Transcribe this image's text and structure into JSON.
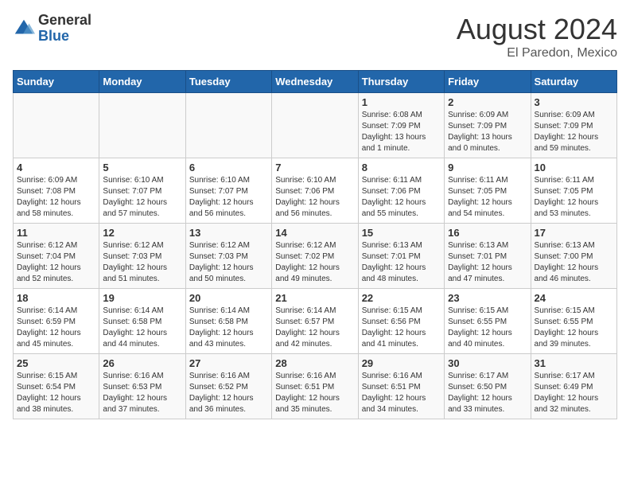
{
  "header": {
    "logo_general": "General",
    "logo_blue": "Blue",
    "month_title": "August 2024",
    "subtitle": "El Paredon, Mexico"
  },
  "days_of_week": [
    "Sunday",
    "Monday",
    "Tuesday",
    "Wednesday",
    "Thursday",
    "Friday",
    "Saturday"
  ],
  "weeks": [
    [
      {
        "num": "",
        "info": ""
      },
      {
        "num": "",
        "info": ""
      },
      {
        "num": "",
        "info": ""
      },
      {
        "num": "",
        "info": ""
      },
      {
        "num": "1",
        "info": "Sunrise: 6:08 AM\nSunset: 7:09 PM\nDaylight: 13 hours\nand 1 minute."
      },
      {
        "num": "2",
        "info": "Sunrise: 6:09 AM\nSunset: 7:09 PM\nDaylight: 13 hours\nand 0 minutes."
      },
      {
        "num": "3",
        "info": "Sunrise: 6:09 AM\nSunset: 7:09 PM\nDaylight: 12 hours\nand 59 minutes."
      }
    ],
    [
      {
        "num": "4",
        "info": "Sunrise: 6:09 AM\nSunset: 7:08 PM\nDaylight: 12 hours\nand 58 minutes."
      },
      {
        "num": "5",
        "info": "Sunrise: 6:10 AM\nSunset: 7:07 PM\nDaylight: 12 hours\nand 57 minutes."
      },
      {
        "num": "6",
        "info": "Sunrise: 6:10 AM\nSunset: 7:07 PM\nDaylight: 12 hours\nand 56 minutes."
      },
      {
        "num": "7",
        "info": "Sunrise: 6:10 AM\nSunset: 7:06 PM\nDaylight: 12 hours\nand 56 minutes."
      },
      {
        "num": "8",
        "info": "Sunrise: 6:11 AM\nSunset: 7:06 PM\nDaylight: 12 hours\nand 55 minutes."
      },
      {
        "num": "9",
        "info": "Sunrise: 6:11 AM\nSunset: 7:05 PM\nDaylight: 12 hours\nand 54 minutes."
      },
      {
        "num": "10",
        "info": "Sunrise: 6:11 AM\nSunset: 7:05 PM\nDaylight: 12 hours\nand 53 minutes."
      }
    ],
    [
      {
        "num": "11",
        "info": "Sunrise: 6:12 AM\nSunset: 7:04 PM\nDaylight: 12 hours\nand 52 minutes."
      },
      {
        "num": "12",
        "info": "Sunrise: 6:12 AM\nSunset: 7:03 PM\nDaylight: 12 hours\nand 51 minutes."
      },
      {
        "num": "13",
        "info": "Sunrise: 6:12 AM\nSunset: 7:03 PM\nDaylight: 12 hours\nand 50 minutes."
      },
      {
        "num": "14",
        "info": "Sunrise: 6:12 AM\nSunset: 7:02 PM\nDaylight: 12 hours\nand 49 minutes."
      },
      {
        "num": "15",
        "info": "Sunrise: 6:13 AM\nSunset: 7:01 PM\nDaylight: 12 hours\nand 48 minutes."
      },
      {
        "num": "16",
        "info": "Sunrise: 6:13 AM\nSunset: 7:01 PM\nDaylight: 12 hours\nand 47 minutes."
      },
      {
        "num": "17",
        "info": "Sunrise: 6:13 AM\nSunset: 7:00 PM\nDaylight: 12 hours\nand 46 minutes."
      }
    ],
    [
      {
        "num": "18",
        "info": "Sunrise: 6:14 AM\nSunset: 6:59 PM\nDaylight: 12 hours\nand 45 minutes."
      },
      {
        "num": "19",
        "info": "Sunrise: 6:14 AM\nSunset: 6:58 PM\nDaylight: 12 hours\nand 44 minutes."
      },
      {
        "num": "20",
        "info": "Sunrise: 6:14 AM\nSunset: 6:58 PM\nDaylight: 12 hours\nand 43 minutes."
      },
      {
        "num": "21",
        "info": "Sunrise: 6:14 AM\nSunset: 6:57 PM\nDaylight: 12 hours\nand 42 minutes."
      },
      {
        "num": "22",
        "info": "Sunrise: 6:15 AM\nSunset: 6:56 PM\nDaylight: 12 hours\nand 41 minutes."
      },
      {
        "num": "23",
        "info": "Sunrise: 6:15 AM\nSunset: 6:55 PM\nDaylight: 12 hours\nand 40 minutes."
      },
      {
        "num": "24",
        "info": "Sunrise: 6:15 AM\nSunset: 6:55 PM\nDaylight: 12 hours\nand 39 minutes."
      }
    ],
    [
      {
        "num": "25",
        "info": "Sunrise: 6:15 AM\nSunset: 6:54 PM\nDaylight: 12 hours\nand 38 minutes."
      },
      {
        "num": "26",
        "info": "Sunrise: 6:16 AM\nSunset: 6:53 PM\nDaylight: 12 hours\nand 37 minutes."
      },
      {
        "num": "27",
        "info": "Sunrise: 6:16 AM\nSunset: 6:52 PM\nDaylight: 12 hours\nand 36 minutes."
      },
      {
        "num": "28",
        "info": "Sunrise: 6:16 AM\nSunset: 6:51 PM\nDaylight: 12 hours\nand 35 minutes."
      },
      {
        "num": "29",
        "info": "Sunrise: 6:16 AM\nSunset: 6:51 PM\nDaylight: 12 hours\nand 34 minutes."
      },
      {
        "num": "30",
        "info": "Sunrise: 6:17 AM\nSunset: 6:50 PM\nDaylight: 12 hours\nand 33 minutes."
      },
      {
        "num": "31",
        "info": "Sunrise: 6:17 AM\nSunset: 6:49 PM\nDaylight: 12 hours\nand 32 minutes."
      }
    ]
  ]
}
